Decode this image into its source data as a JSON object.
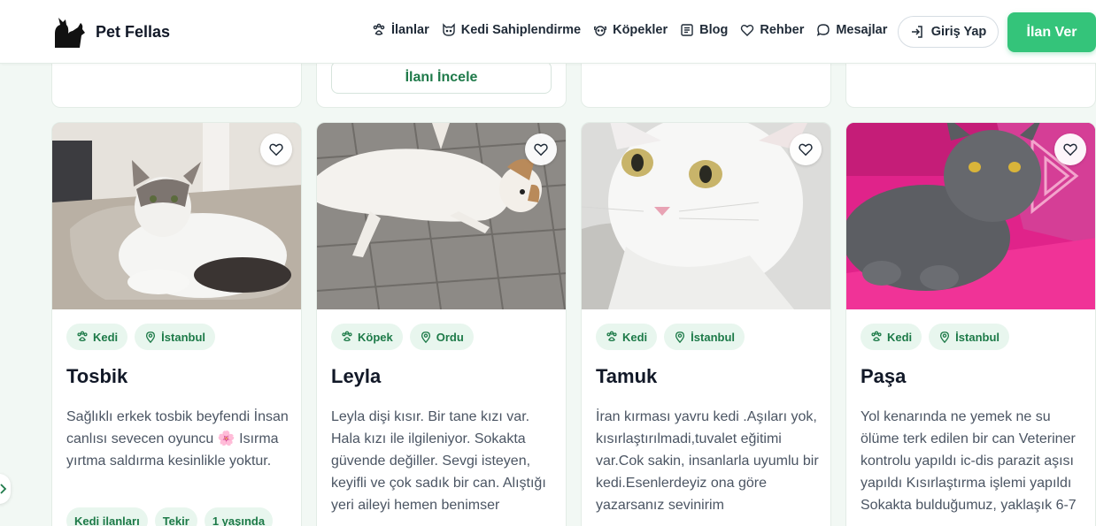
{
  "brand": {
    "name": "Pet Fellas"
  },
  "nav": [
    {
      "label": "İlanlar",
      "icon": "paw-icon"
    },
    {
      "label": "Kedi Sahiplendirme",
      "icon": "cat-face-icon"
    },
    {
      "label": "Köpekler",
      "icon": "dog-face-icon"
    },
    {
      "label": "Blog",
      "icon": "newspaper-icon"
    },
    {
      "label": "Rehber",
      "icon": "heart-hand-icon"
    },
    {
      "label": "Mesajlar",
      "icon": "chat-bubble-icon"
    }
  ],
  "header": {
    "login_label": "Giriş Yap",
    "post_label": "İlan Ver"
  },
  "top_cards": {
    "inspect_label": "İlanı İncele"
  },
  "colors": {
    "accent": "#34c47a",
    "tag_bg": "#e8f6ee",
    "tag_text": "#1d7a48"
  },
  "cards": [
    {
      "tags": [
        "Kedi",
        "İstanbul"
      ],
      "name": "Tosbik",
      "description": "Sağlıklı erkek tosbik beyfendi İnsan canlısı sevecen oyuncu 🌸 Isırma yırtma saldırma kesinlikle yoktur.",
      "extra_tags": [
        "Kedi ilanları",
        "Tekir",
        "1 yaşında"
      ]
    },
    {
      "tags": [
        "Köpek",
        "Ordu"
      ],
      "name": "Leyla",
      "description": "Leyla dişi kısır. Bir tane kızı var. Hala kızı ile ilgileniyor. Sokakta güvende değiller. Sevgi isteyen, keyifli ve çok sadık bir can. Alıştığı yeri aileyi hemen benimser"
    },
    {
      "tags": [
        "Kedi",
        "İstanbul"
      ],
      "name": "Tamuk",
      "description": "İran kırması yavru kedi .Aşıları yok, kısırlaştırılmadi,tuvalet eğitimi var.Cok sakin, insanlarla uyumlu bir kedi.Esenlerdeyiz ona göre yazarsanız sevinirim"
    },
    {
      "tags": [
        "Kedi",
        "İstanbul"
      ],
      "name": "Paşa",
      "description": "Yol kenarında ne yemek ne su ölüme terk edilen bir can Veteriner kontrolu yapıldı ic-dis parazit aşısı yapıldı Kısırlaştırma işlemi yapıldı Sokakta bulduğumuz, yaklaşık 6-7"
    }
  ]
}
